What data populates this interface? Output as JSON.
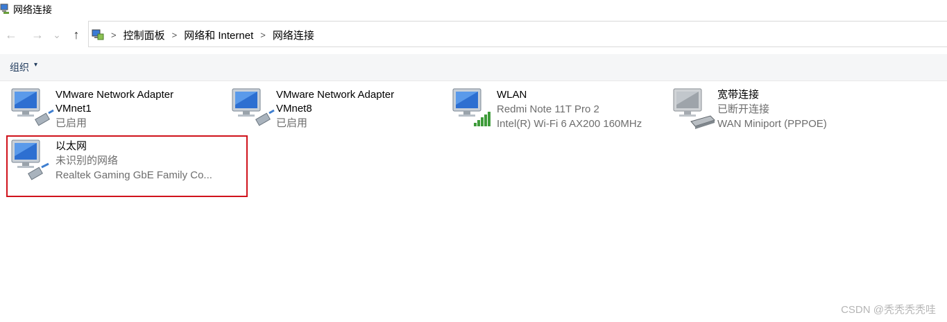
{
  "window": {
    "title": "网络连接"
  },
  "nav": {
    "back": "←",
    "forward": "→",
    "recent": "⌄",
    "up": "↑"
  },
  "breadcrumb": [
    "控制面板",
    "网络和 Internet",
    "网络连接"
  ],
  "breadcrumb_sep": ">",
  "toolbar": {
    "organize_label": "组织",
    "organize_caret": "▾"
  },
  "adapters": [
    {
      "name": "VMware Network Adapter",
      "name2": "VMnet1",
      "line2": "",
      "line3": "已启用",
      "badge": "cable"
    },
    {
      "name": "VMware Network Adapter",
      "name2": "VMnet8",
      "line2": "",
      "line3": "已启用",
      "badge": "cable"
    },
    {
      "name": "WLAN",
      "name2": "",
      "line2": "Redmi Note 11T Pro 2",
      "line3": "Intel(R) Wi-Fi 6 AX200 160MHz",
      "badge": "wifi-bars"
    },
    {
      "name": "宽带连接",
      "name2": "",
      "line2": "已断开连接",
      "line3": "WAN Miniport (PPPOE)",
      "badge": "modem"
    },
    {
      "name": "以太网",
      "name2": "",
      "line2": "未识别的网络",
      "line3": "Realtek Gaming GbE Family Co...",
      "badge": "cable"
    }
  ],
  "watermark": "CSDN @秃秃秃秃哇",
  "colors": {
    "highlight": "#d0121b",
    "toolbar_bg": "#f5f6f7",
    "text_secondary": "#6d6d6d"
  }
}
